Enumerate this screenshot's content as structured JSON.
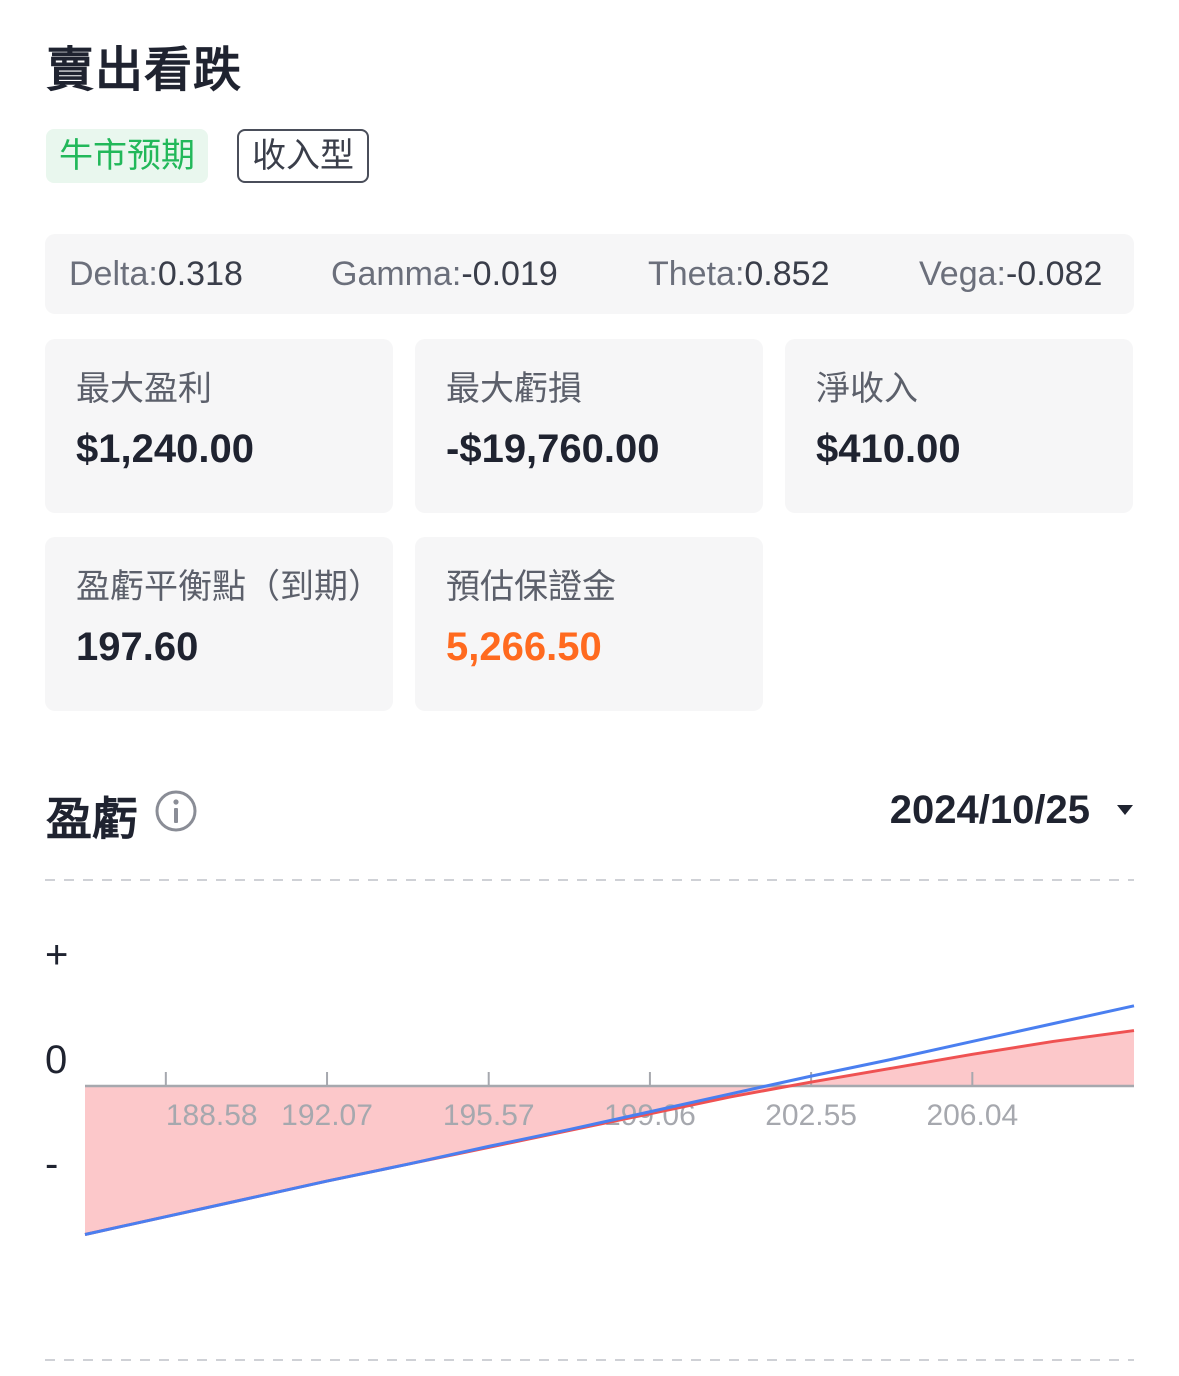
{
  "header": {
    "title": "賣出看跌"
  },
  "tags": [
    {
      "label": "牛市预期",
      "style": "green"
    },
    {
      "label": "收入型",
      "style": "outline"
    }
  ],
  "greeks": [
    {
      "name": "Delta:",
      "value": "0.318"
    },
    {
      "name": "Gamma:",
      "value": "-0.019"
    },
    {
      "name": "Theta:",
      "value": "0.852"
    },
    {
      "name": "Vega:",
      "value": "-0.082"
    }
  ],
  "metrics": [
    {
      "label": "最大盈利",
      "value": "$1,240.00"
    },
    {
      "label": "最大虧損",
      "value": "-$19,760.00"
    },
    {
      "label": "淨收入",
      "value": "$410.00"
    },
    {
      "label": "盈虧平衡點（到期）",
      "value": "197.60"
    },
    {
      "label": "預估保證金",
      "value": "5,266.50",
      "color": "#ff6a1f"
    }
  ],
  "pl_section": {
    "title": "盈虧",
    "info_icon": "info-circle-icon",
    "date": "2024/10/25",
    "dropdown_icon": "caret-down-icon"
  },
  "chart_data": {
    "type": "line",
    "y_axis_labels": [
      "+",
      "0",
      "-"
    ],
    "x_ticks": [
      "188.58",
      "192.07",
      "195.57",
      "199.06",
      "202.55",
      "206.04"
    ],
    "xlim": [
      186.83,
      209.54
    ],
    "x": [
      186.83,
      188.58,
      190.33,
      192.07,
      193.82,
      195.57,
      197.31,
      199.06,
      200.8,
      202.55,
      204.3,
      206.04,
      207.79,
      209.54
    ],
    "series": [
      {
        "color": "#4a7ff0",
        "values": [
          -150,
          -132,
          -114,
          -96,
          -79,
          -61,
          -44,
          -26,
          -8,
          10,
          27,
          45,
          63,
          81
        ]
      },
      {
        "color": "#ef5252",
        "fill": "#fcc8ca",
        "values": [
          -150,
          -132,
          -114,
          -96,
          -79,
          -62,
          -45,
          -28,
          -11,
          4,
          18,
          32,
          45,
          56
        ]
      }
    ],
    "grid_dashed_lines": true,
    "colors": {
      "axis": "#a6a8ae",
      "tick_label": "#a6a8ae",
      "grid": "#cfd1d6"
    }
  }
}
